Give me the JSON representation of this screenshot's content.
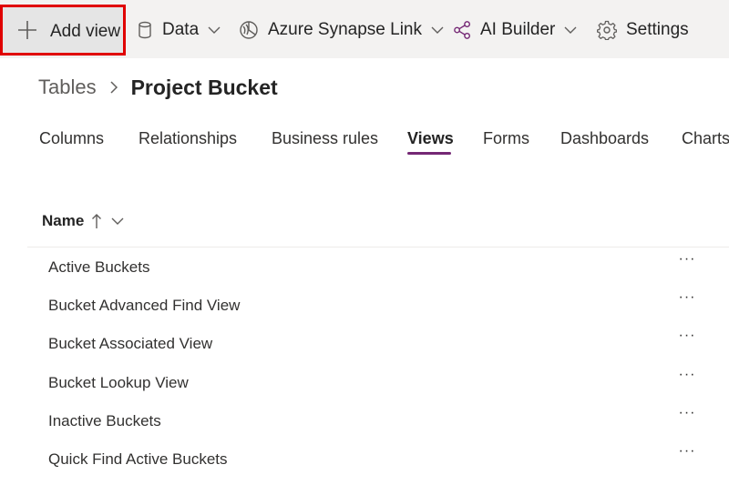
{
  "command_bar": {
    "add_view": "Add view",
    "data": "Data",
    "azure_synapse_link": "Azure Synapse Link",
    "ai_builder": "AI Builder",
    "settings": "Settings"
  },
  "breadcrumb": {
    "parent": "Tables",
    "current": "Project Bucket"
  },
  "tabs": [
    {
      "label": "Columns"
    },
    {
      "label": "Relationships"
    },
    {
      "label": "Business rules"
    },
    {
      "label": "Views",
      "active": true
    },
    {
      "label": "Forms"
    },
    {
      "label": "Dashboards"
    },
    {
      "label": "Charts"
    }
  ],
  "grid": {
    "column_header": "Name",
    "sort": "ascending",
    "rows": [
      {
        "name": "Active Buckets",
        "more": "···"
      },
      {
        "name": "Bucket Advanced Find View",
        "more": "···"
      },
      {
        "name": "Bucket Associated View",
        "more": "···"
      },
      {
        "name": "Bucket Lookup View",
        "more": "···"
      },
      {
        "name": "Inactive Buckets",
        "more": "···"
      },
      {
        "name": "Quick Find Active Buckets",
        "more": "···"
      }
    ]
  },
  "colors": {
    "accent": "#742774",
    "highlight_box": "#e00000",
    "command_bar_bg": "#f3f2f1"
  },
  "icons": {
    "add_view": "plus-icon",
    "data": "database-icon",
    "azure_synapse_link": "synapse-icon",
    "ai_builder": "ai-builder-icon",
    "settings": "gear-icon",
    "dropdown": "chevron-down-icon",
    "breadcrumb_separator": "chevron-right-icon",
    "sort": "arrow-up-icon",
    "row_actions": "more-icon"
  }
}
